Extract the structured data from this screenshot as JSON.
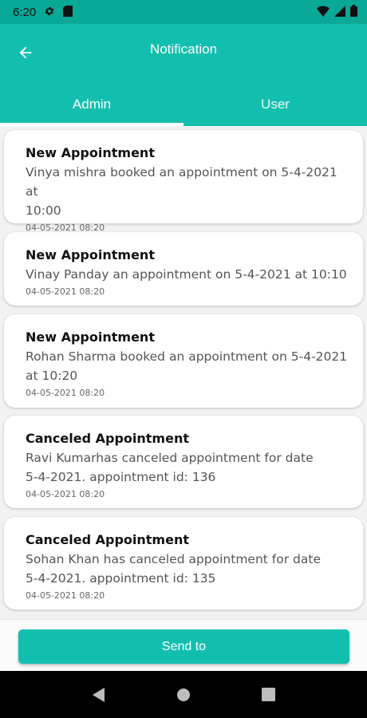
{
  "status_bar": {
    "time": "6:20",
    "icons": [
      "gear-icon",
      "sd-card-icon",
      "wifi-icon",
      "signal-icon",
      "battery-icon"
    ]
  },
  "app_bar": {
    "title": "Notification",
    "back_icon": "arrow-left-icon",
    "color": "#12bfae"
  },
  "tabs": [
    {
      "label": "Admin",
      "selected": true
    },
    {
      "label": "User",
      "selected": false
    }
  ],
  "notifications": [
    {
      "title": "New Appointment",
      "message_lines": [
        "Vinya mishra booked an appointment on 5-4-2021 at",
        "10:00"
      ],
      "date": "04-05-2021 08:20"
    },
    {
      "title": "New Appointment",
      "message_lines": [
        "Vinay Panday an appointment on 5-4-2021 at 10:10"
      ],
      "date": "04-05-2021 08:20"
    },
    {
      "title": "New Appointment",
      "message_lines": [
        "Rohan Sharma booked an appointment on 5-4-2021",
        "at 10:20"
      ],
      "date": "04-05-2021 08:20"
    },
    {
      "title": "Canceled Appointment",
      "message_lines": [
        "Ravi Kumarhas canceled appointment for date",
        "5-4-2021. appointment id: 136"
      ],
      "date": "04-05-2021 08:20"
    },
    {
      "title": "Canceled Appointment",
      "message_lines": [
        "Sohan Khan has canceled appointment for date",
        "5-4-2021. appointment id: 135"
      ],
      "date": "04-05-2021 08:20"
    }
  ],
  "footer": {
    "button_label": "Send to"
  },
  "nav_bar": {
    "icons": [
      "back-triangle-icon",
      "home-circle-icon",
      "recents-square-icon"
    ]
  }
}
